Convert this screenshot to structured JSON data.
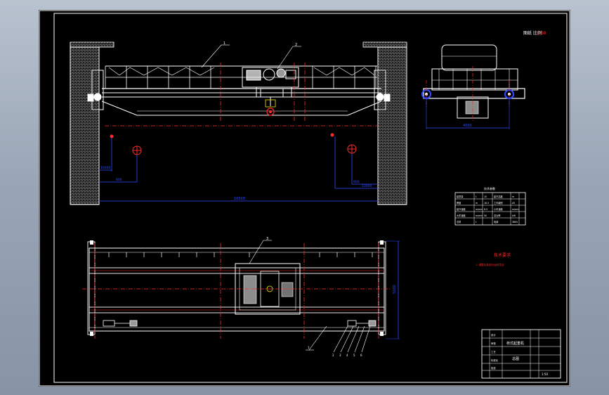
{
  "drawing": {
    "sheet_label": "图纸 比例",
    "scale_value": "1:50",
    "callouts": {
      "girder": "1",
      "trolley": "2",
      "plan_trolley": "3",
      "list": [
        "1",
        "2",
        "3",
        "4",
        "5",
        "6"
      ]
    },
    "dims": {
      "span": "16500",
      "left_lift": "10000",
      "left_small": "800",
      "right_lift": "10000",
      "right_small": "800",
      "end_wheelbase": "4000",
      "plan_width": "5000"
    },
    "tech_table": {
      "title": "技术参数",
      "rows": [
        [
          "起重量",
          "t",
          "10",
          "起升高度",
          "m"
        ],
        [
          "跨度",
          "m",
          "16.5",
          "工作级别",
          "A5"
        ],
        [
          "起升速度",
          "m/min",
          "8.5",
          "小车速度",
          "m/min"
        ],
        [
          "大车速度",
          "m/min",
          "90",
          "总功率",
          "kW"
        ],
        [
          "总重",
          "t",
          "",
          "电源",
          "380V"
        ]
      ]
    },
    "tech_req": {
      "title": "技术要求",
      "line": "1. 调整后各部分运转灵活"
    },
    "title_block": {
      "title": "桥式起重机",
      "drawing_no": "总图",
      "rows": [
        "设计",
        "审核",
        "工艺",
        "标准化",
        "批准"
      ],
      "scale": "1:50"
    }
  },
  "colors": {
    "background": "#000000",
    "line": "#ffffff",
    "red": "#ff2a2a",
    "blue": "#2f4bff",
    "yellow": "#ffe600",
    "green": "#2bd42b",
    "cyan": "#35d8ff"
  }
}
